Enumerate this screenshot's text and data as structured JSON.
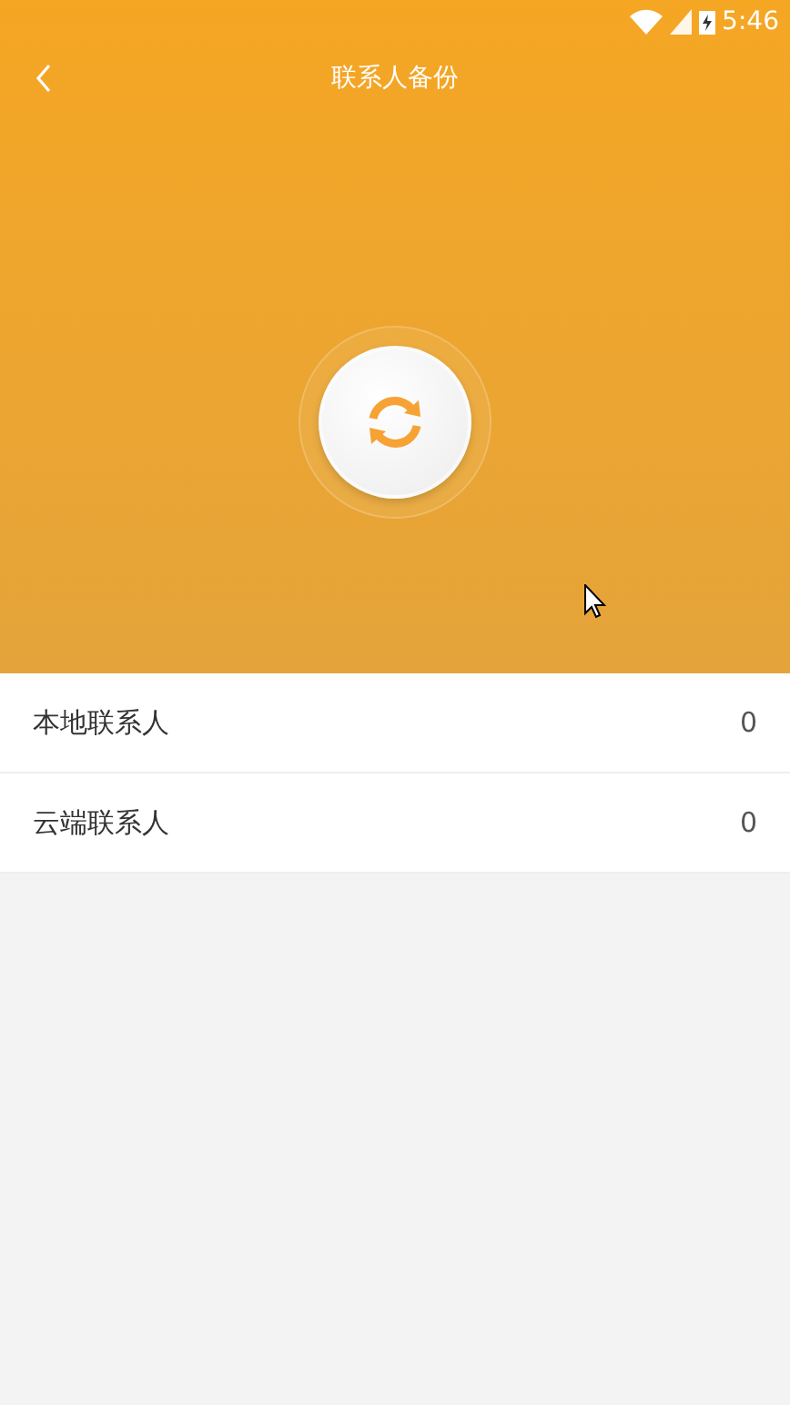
{
  "status_bar": {
    "time": "5:46"
  },
  "header": {
    "title": "联系人备份"
  },
  "rows": [
    {
      "label": "本地联系人",
      "count": "0"
    },
    {
      "label": "云端联系人",
      "count": "0"
    }
  ]
}
